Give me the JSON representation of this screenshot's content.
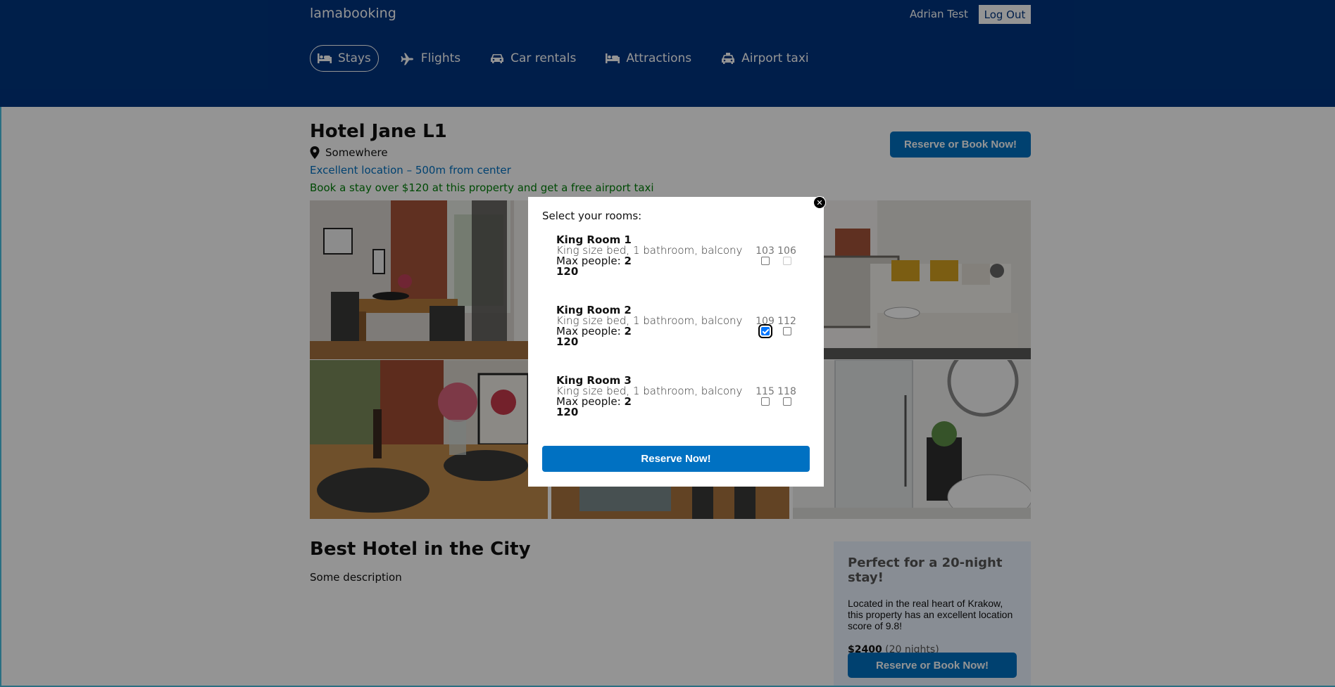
{
  "header": {
    "logo": "lamabooking",
    "user_name": "Adrian Test",
    "logout_label": "Log Out",
    "nav": [
      {
        "label": "Stays",
        "icon": "bed-icon",
        "active": true
      },
      {
        "label": "Flights",
        "icon": "plane-icon",
        "active": false
      },
      {
        "label": "Car rentals",
        "icon": "car-icon",
        "active": false
      },
      {
        "label": "Attractions",
        "icon": "bed-icon",
        "active": false
      },
      {
        "label": "Airport taxi",
        "icon": "taxi-icon",
        "active": false
      }
    ]
  },
  "hotel": {
    "name": "Hotel Jane L1",
    "address": "Somewhere",
    "distance": "Excellent location – 500m from center",
    "promo": "Book a stay over $120 at this property and get a free airport taxi",
    "reserve_button": "Reserve or Book Now!",
    "desc_title": "Best Hotel in the City",
    "desc_text": "Some description"
  },
  "price_box": {
    "heading": "Perfect for a 20-night stay!",
    "text": "Located in the real heart of Krakow, this property has an excellent location score of 9.8!",
    "price": "$2400",
    "nights": "(20 nights)",
    "button": "Reserve or Book Now!"
  },
  "modal": {
    "heading": "Select your rooms:",
    "close_icon": "close-icon",
    "max_label": "Max people: ",
    "rooms": [
      {
        "title": "King Room 1",
        "desc": "King size bed, 1 bathroom, balcony",
        "max": "2",
        "price": "120",
        "numbers": [
          {
            "num": "103",
            "checked": false,
            "disabled": false
          },
          {
            "num": "106",
            "checked": false,
            "disabled": true
          }
        ]
      },
      {
        "title": "King Room 2",
        "desc": "King size bed, 1 bathroom, balcony",
        "max": "2",
        "price": "120",
        "numbers": [
          {
            "num": "109",
            "checked": true,
            "disabled": false
          },
          {
            "num": "112",
            "checked": false,
            "disabled": false
          }
        ]
      },
      {
        "title": "King Room 3",
        "desc": "King size bed, 1 bathroom, balcony",
        "max": "2",
        "price": "120",
        "numbers": [
          {
            "num": "115",
            "checked": false,
            "disabled": false
          },
          {
            "num": "118",
            "checked": false,
            "disabled": false
          }
        ]
      }
    ],
    "reserve_label": "Reserve Now!"
  },
  "colors": {
    "header_bg": "#003580",
    "primary": "#0071c2",
    "promo_green": "#008009",
    "price_box_bg": "#ebf3ff"
  }
}
